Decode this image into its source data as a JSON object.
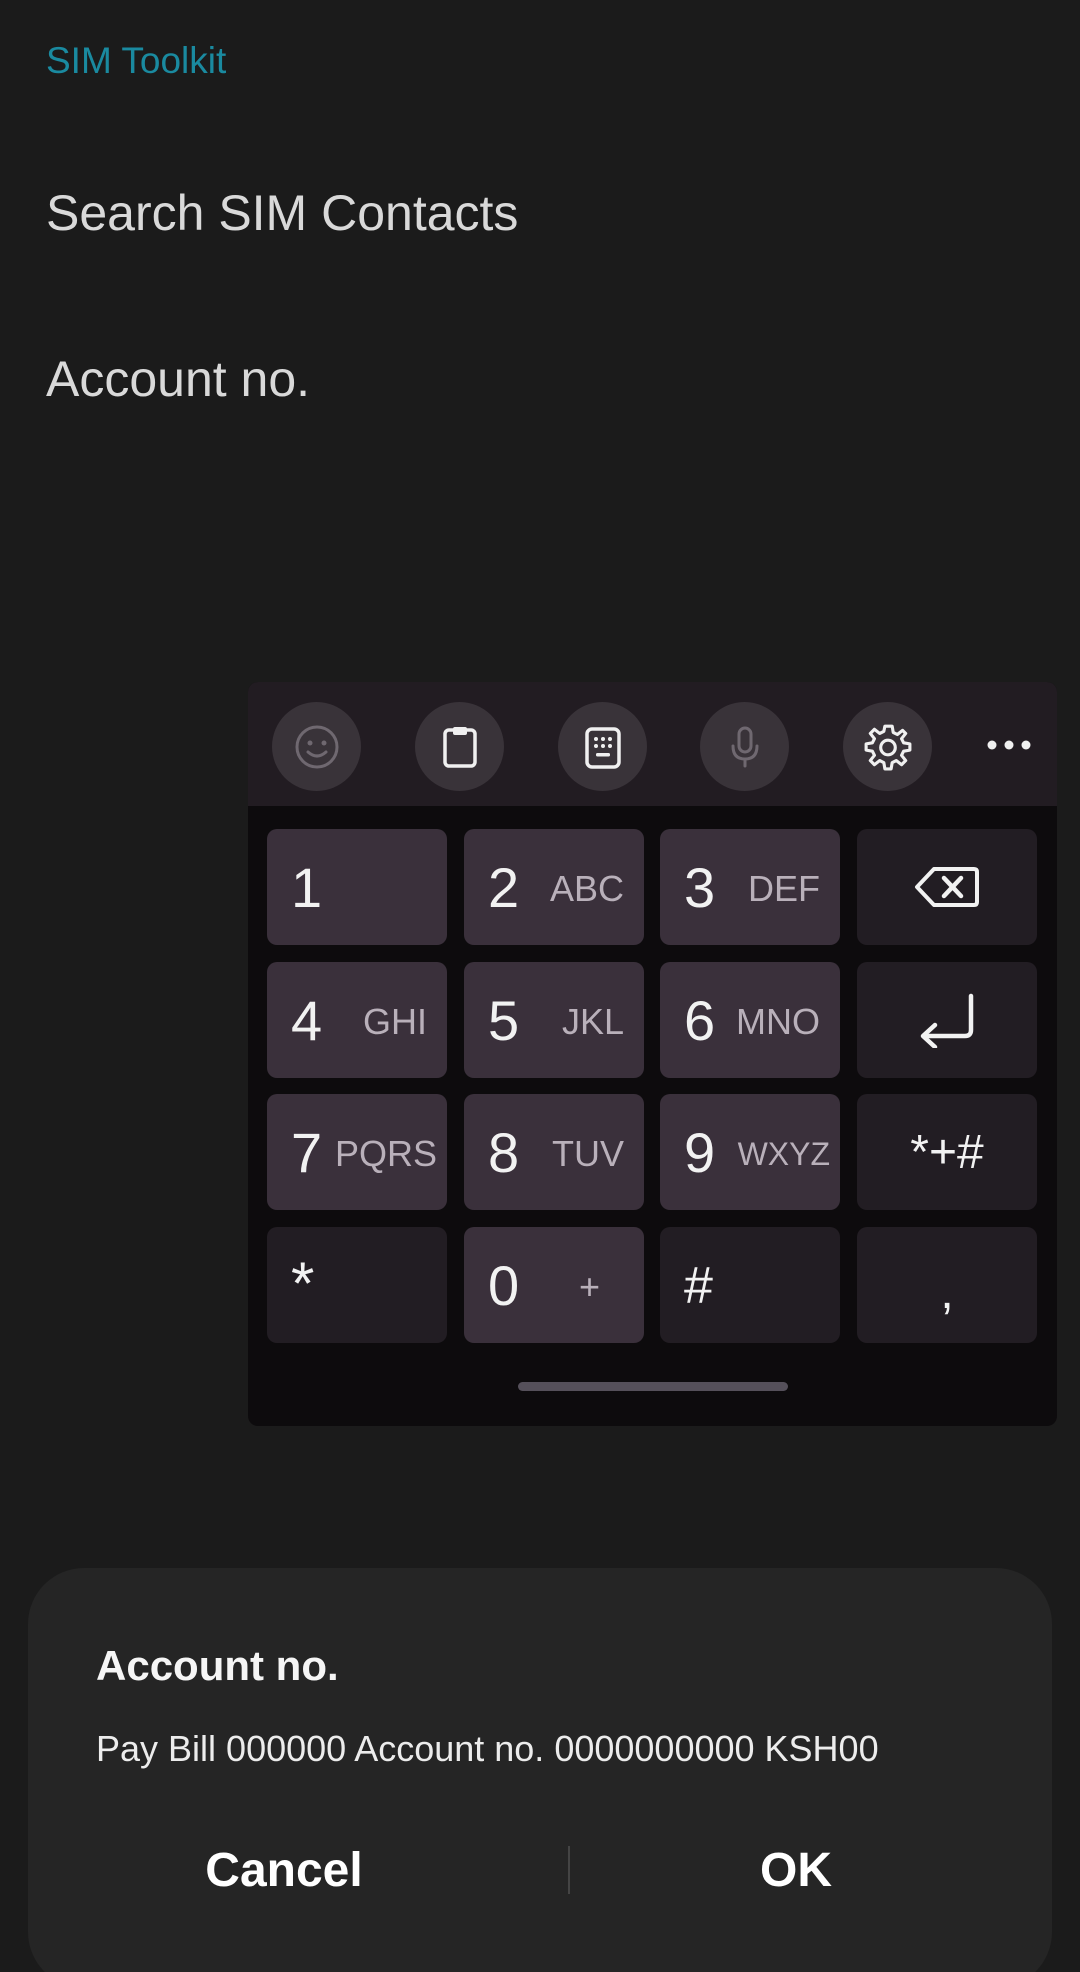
{
  "app": {
    "title": "SIM Toolkit",
    "accent_color": "#1a8aa0"
  },
  "menu": {
    "items": [
      {
        "label": "Search SIM Contacts"
      },
      {
        "label": "Account no."
      }
    ]
  },
  "keyboard": {
    "toolbar": {
      "icons": [
        "emoji-icon",
        "clipboard-icon",
        "keypad-icon",
        "microphone-icon",
        "settings-icon",
        "more-icon"
      ]
    },
    "keys": {
      "k1": {
        "num": "1",
        "letters": ""
      },
      "k2": {
        "num": "2",
        "letters": "ABC"
      },
      "k3": {
        "num": "3",
        "letters": "DEF"
      },
      "k4": {
        "num": "4",
        "letters": "GHI"
      },
      "k5": {
        "num": "5",
        "letters": "JKL"
      },
      "k6": {
        "num": "6",
        "letters": "MNO"
      },
      "k7": {
        "num": "7",
        "letters": "PQRS"
      },
      "k8": {
        "num": "8",
        "letters": "TUV"
      },
      "k9": {
        "num": "9",
        "letters": "WXYZ"
      },
      "k0": {
        "num": "0",
        "letters": "+"
      },
      "star": {
        "label": "*"
      },
      "hash": {
        "label": "#"
      },
      "symbols": {
        "label": "*+#"
      },
      "comma": {
        "label": ","
      }
    }
  },
  "dialog": {
    "title": "Account no.",
    "message": "Pay Bill 000000 Account no. 0000000000 KSH00",
    "cancel_label": "Cancel",
    "ok_label": "OK"
  }
}
